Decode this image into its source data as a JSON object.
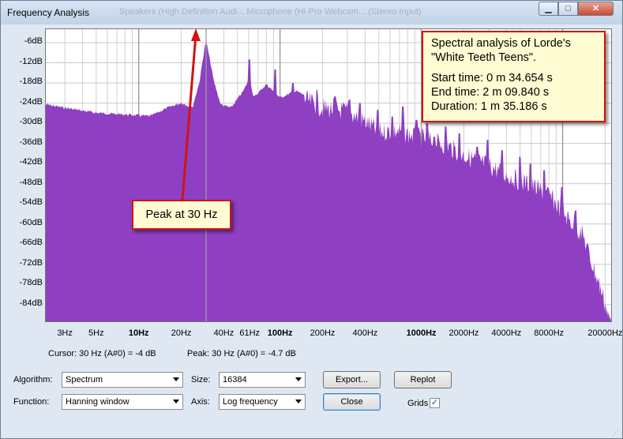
{
  "window": {
    "title": "Frequency Analysis",
    "background_tabs": "Speakers (High Definition Audi...      Microphone (Hi-Pro Webcam...      (Stereo Input)",
    "min_glyph": "▁",
    "max_glyph": "□",
    "close_glyph": "✕"
  },
  "chart_data": {
    "type": "area",
    "x_scale": "log",
    "xlim_hz": [
      2.2,
      22050
    ],
    "ylim_db": [
      -89,
      -2
    ],
    "grid": true,
    "fill_color": "#8e3fc2",
    "y_ticks": [
      "-6dB",
      "-12dB",
      "-18dB",
      "-24dB",
      "-30dB",
      "-36dB",
      "-42dB",
      "-48dB",
      "-54dB",
      "-60dB",
      "-66dB",
      "-72dB",
      "-78dB",
      "-84dB"
    ],
    "y_tick_values": [
      -6,
      -12,
      -18,
      -24,
      -30,
      -36,
      -42,
      -48,
      -54,
      -60,
      -66,
      -72,
      -78,
      -84
    ],
    "x_ticks": [
      {
        "label": "3Hz",
        "hz": 3,
        "major": false
      },
      {
        "label": "5Hz",
        "hz": 5,
        "major": false
      },
      {
        "label": "10Hz",
        "hz": 10,
        "major": true
      },
      {
        "label": "20Hz",
        "hz": 20,
        "major": false
      },
      {
        "label": "40Hz",
        "hz": 40,
        "major": false
      },
      {
        "label": "61Hz",
        "hz": 61,
        "major": false
      },
      {
        "label": "100Hz",
        "hz": 100,
        "major": true
      },
      {
        "label": "200Hz",
        "hz": 200,
        "major": false
      },
      {
        "label": "400Hz",
        "hz": 400,
        "major": false
      },
      {
        "label": "1000Hz",
        "hz": 1000,
        "major": true
      },
      {
        "label": "2000Hz",
        "hz": 2000,
        "major": false
      },
      {
        "label": "4000Hz",
        "hz": 4000,
        "major": false
      },
      {
        "label": "8000Hz",
        "hz": 8000,
        "major": false
      },
      {
        "label": "20000Hz",
        "hz": 20000,
        "major": false
      }
    ],
    "envelope": [
      {
        "hz": 2.2,
        "db": -24
      },
      {
        "hz": 3,
        "db": -25
      },
      {
        "hz": 5,
        "db": -26.5
      },
      {
        "hz": 8,
        "db": -27
      },
      {
        "hz": 12,
        "db": -27.5
      },
      {
        "hz": 16,
        "db": -25
      },
      {
        "hz": 20,
        "db": -23.5
      },
      {
        "hz": 24,
        "db": -25
      },
      {
        "hz": 27,
        "db": -17
      },
      {
        "hz": 29,
        "db": -8
      },
      {
        "hz": 30,
        "db": -5.2
      },
      {
        "hz": 31,
        "db": -8
      },
      {
        "hz": 34,
        "db": -17
      },
      {
        "hz": 38,
        "db": -24
      },
      {
        "hz": 45,
        "db": -25
      },
      {
        "hz": 55,
        "db": -20
      },
      {
        "hz": 61,
        "db": -16
      },
      {
        "hz": 65,
        "db": -22
      },
      {
        "hz": 80,
        "db": -18
      },
      {
        "hz": 100,
        "db": -22
      },
      {
        "hz": 130,
        "db": -20
      },
      {
        "hz": 200,
        "db": -24
      },
      {
        "hz": 300,
        "db": -25
      },
      {
        "hz": 400,
        "db": -28
      },
      {
        "hz": 500,
        "db": -31
      },
      {
        "hz": 700,
        "db": -31
      },
      {
        "hz": 1000,
        "db": -33
      },
      {
        "hz": 1500,
        "db": -35
      },
      {
        "hz": 2000,
        "db": -38
      },
      {
        "hz": 3000,
        "db": -41
      },
      {
        "hz": 4000,
        "db": -44
      },
      {
        "hz": 6000,
        "db": -47
      },
      {
        "hz": 8000,
        "db": -50
      },
      {
        "hz": 11000,
        "db": -57
      },
      {
        "hz": 14000,
        "db": -62
      },
      {
        "hz": 16000,
        "db": -70
      },
      {
        "hz": 18000,
        "db": -76
      },
      {
        "hz": 20000,
        "db": -82
      },
      {
        "hz": 22050,
        "db": -89
      }
    ],
    "spikes": [
      {
        "hz": 61,
        "db": -11
      },
      {
        "hz": 92,
        "db": -14
      },
      {
        "hz": 123,
        "db": -18
      },
      {
        "hz": 182,
        "db": -20
      },
      {
        "hz": 245,
        "db": -22
      },
      {
        "hz": 310,
        "db": -23
      },
      {
        "hz": 370,
        "db": -24
      },
      {
        "hz": 490,
        "db": -26
      },
      {
        "hz": 620,
        "db": -28
      },
      {
        "hz": 740,
        "db": -25
      },
      {
        "hz": 930,
        "db": -29
      },
      {
        "hz": 1100,
        "db": -30
      },
      {
        "hz": 1240,
        "db": -34
      },
      {
        "hz": 1480,
        "db": -31
      },
      {
        "hz": 1860,
        "db": -33
      },
      {
        "hz": 2480,
        "db": -37
      },
      {
        "hz": 2960,
        "db": -35
      },
      {
        "hz": 3720,
        "db": -38
      },
      {
        "hz": 4960,
        "db": -40
      },
      {
        "hz": 5900,
        "db": -42
      },
      {
        "hz": 7400,
        "db": -44
      },
      {
        "hz": 9900,
        "db": -49
      },
      {
        "hz": 12400,
        "db": -56
      }
    ],
    "peak_hz": 30,
    "peak_db": -4.7
  },
  "annotations": {
    "info_lines": [
      "Spectral analysis of Lorde's",
      "\"White Teeth Teens\".",
      "Start time:  0 m 34.654 s",
      "End time:  2 m 09.840 s",
      "Duration:  1 m 35.186 s"
    ],
    "peak_label": "Peak at 30 Hz"
  },
  "readout": {
    "cursor": "Cursor: 30 Hz (A#0) = -4 dB",
    "peak": "Peak: 30 Hz (A#0) = -4.7 dB"
  },
  "controls": {
    "algorithm_label": "Algorithm:",
    "algorithm_value": "Spectrum",
    "size_label": "Size:",
    "size_value": "16384",
    "function_label": "Function:",
    "function_value": "Hanning window",
    "axis_label": "Axis:",
    "axis_value": "Log frequency",
    "export_button": "Export...",
    "replot_button": "Replot",
    "close_button": "Close",
    "grids_label": "Grids",
    "grids_checked": "✓"
  }
}
